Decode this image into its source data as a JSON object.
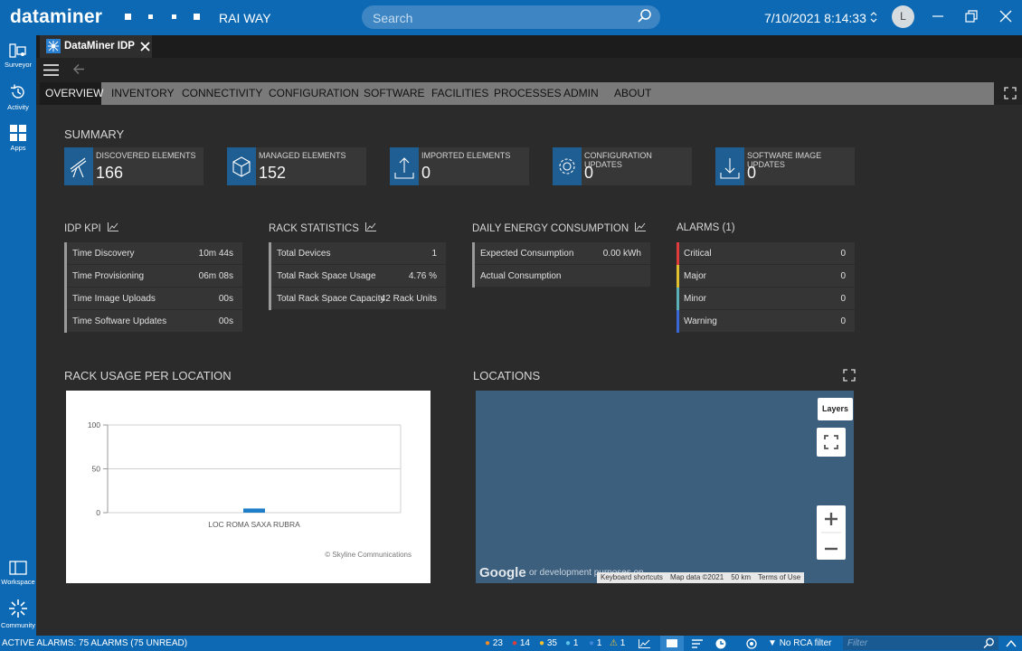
{
  "titlebar": {
    "logo": "dataminer",
    "system_name": "RAI WAY",
    "search_placeholder": "Search",
    "datetime": "7/10/2021 8:14:33",
    "user_initial": "L"
  },
  "leftbar": {
    "items": [
      {
        "label": "Surveyor",
        "icon": "surveyor-icon"
      },
      {
        "label": "Activity",
        "icon": "activity-icon"
      },
      {
        "label": "Apps",
        "icon": "apps-icon"
      }
    ],
    "bottom_items": [
      {
        "label": "Workspace",
        "icon": "workspace-icon"
      },
      {
        "label": "Community",
        "icon": "community-icon"
      }
    ]
  },
  "app_tab": {
    "label": "DataMiner IDP"
  },
  "nav": {
    "tabs": [
      "OVERVIEW",
      "INVENTORY",
      "CONNECTIVITY",
      "CONFIGURATION",
      "SOFTWARE",
      "FACILITIES",
      "PROCESSES",
      "ADMIN",
      "ABOUT"
    ],
    "active": "OVERVIEW"
  },
  "summary": {
    "title": "SUMMARY",
    "cards": [
      {
        "label": "DISCOVERED ELEMENTS",
        "value": "166",
        "icon": "telescope-icon"
      },
      {
        "label": "MANAGED ELEMENTS",
        "value": "152",
        "icon": "cube-icon"
      },
      {
        "label": "IMPORTED ELEMENTS",
        "value": "0",
        "icon": "upload-icon"
      },
      {
        "label": "CONFIGURATION UPDATES",
        "value": "0",
        "icon": "gear-icon"
      },
      {
        "label": "SOFTWARE IMAGE UPDATES",
        "value": "0",
        "icon": "download-icon"
      }
    ]
  },
  "idp_kpi": {
    "title": "IDP KPI",
    "rows": [
      {
        "label": "Time Discovery",
        "value": "10m 44s"
      },
      {
        "label": "Time Provisioning",
        "value": "06m 08s"
      },
      {
        "label": "Time Image Uploads",
        "value": "00s"
      },
      {
        "label": "Time Software Updates",
        "value": "00s"
      }
    ]
  },
  "rack_stats": {
    "title": "RACK STATISTICS",
    "rows": [
      {
        "label": "Total Devices",
        "value": "1"
      },
      {
        "label": "Total Rack Space Usage",
        "value": "4.76 %"
      },
      {
        "label": "Total Rack Space Capacity",
        "value": "42 Rack Units"
      }
    ]
  },
  "energy": {
    "title": "DAILY ENERGY CONSUMPTION",
    "rows": [
      {
        "label": "Expected Consumption",
        "value": "0.00 kWh"
      },
      {
        "label": "Actual Consumption",
        "value": ""
      }
    ]
  },
  "alarms": {
    "title": "ALARMS (1)",
    "rows": [
      {
        "label": "Critical",
        "value": "0",
        "color": "#e03c3c"
      },
      {
        "label": "Major",
        "value": "0",
        "color": "#e0c030"
      },
      {
        "label": "Minor",
        "value": "0",
        "color": "#5bb0b8"
      },
      {
        "label": "Warning",
        "value": "0",
        "color": "#3b66d6"
      }
    ]
  },
  "rack_usage": {
    "title": "RACK USAGE PER LOCATION",
    "credit": "© Skyline Communications"
  },
  "chart_data": {
    "type": "bar",
    "categories": [
      "LOC ROMA SAXA RUBRA"
    ],
    "values": [
      4.76
    ],
    "ylim": [
      0,
      100
    ],
    "yticks": [
      "100",
      "50",
      "0"
    ],
    "bar_color": "#1f7ec8",
    "grid": true
  },
  "locations": {
    "title": "LOCATIONS",
    "layers_label": "Layers",
    "google": "Google",
    "dev_text": "or development purposes on",
    "keyboard": "Keyboard shortcuts",
    "mapdata": "Map data ©2021",
    "scale": "50 km",
    "terms": "Terms of Use"
  },
  "status": {
    "active_alarms": "ACTIVE ALARMS: 75 ALARMS (75 UNREAD)",
    "counts": [
      {
        "value": "23",
        "color": "#f08a24"
      },
      {
        "value": "14",
        "color": "#e03c3c"
      },
      {
        "value": "35",
        "color": "#f0c030"
      },
      {
        "value": "1",
        "color": "#5bc0e8"
      },
      {
        "value": "1",
        "color": "#3b86d6"
      }
    ],
    "warning_count": "1",
    "no_rca": "No RCA filter",
    "filter_placeholder": "Filter"
  }
}
